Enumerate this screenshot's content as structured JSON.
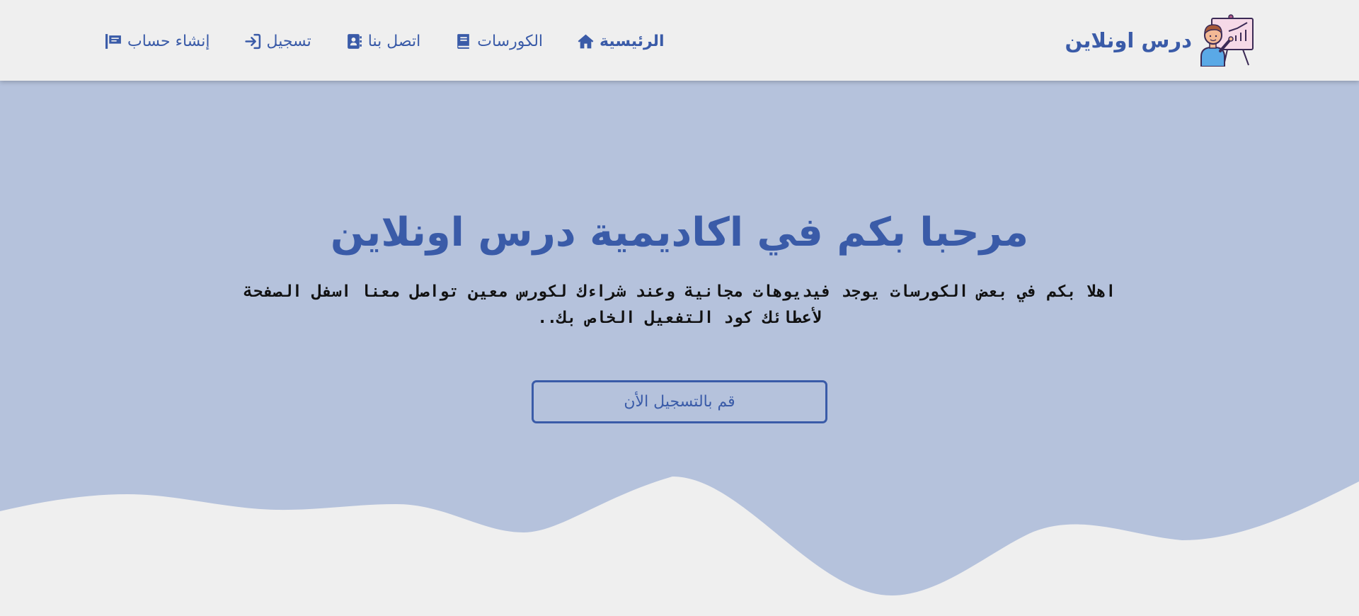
{
  "brand": {
    "name": "درس اونلاين",
    "logo_icon": "teacher-presentation-icon"
  },
  "nav": {
    "items": [
      {
        "id": "home",
        "label": "الرئيسية",
        "icon": "home-icon",
        "active": true
      },
      {
        "id": "courses",
        "label": "الكورسات",
        "icon": "book-icon",
        "active": false
      },
      {
        "id": "contact",
        "label": "اتصل بنا",
        "icon": "address-book-icon",
        "active": false
      },
      {
        "id": "login",
        "label": "تسجيل",
        "icon": "sign-in-icon",
        "active": false
      },
      {
        "id": "register",
        "label": "إنشاء حساب",
        "icon": "flag-icon",
        "active": false
      }
    ]
  },
  "hero": {
    "title": "مرحبا بكم في اكاديمية درس اونلاين",
    "description": "اهلا بكم في بعض الكورسات يوجد فيديوهات مجانية وعند شراءك لكورس معين تواصل معنا اسفل الصفحة لأعطائك كود التفعيل الخاص بك..",
    "cta_label": "قم بالتسجيل الأن"
  },
  "colors": {
    "primary": "#3a5ba8",
    "hero_background": "#b5c2dc",
    "page_background": "#efefef",
    "text_dark": "#111111"
  }
}
